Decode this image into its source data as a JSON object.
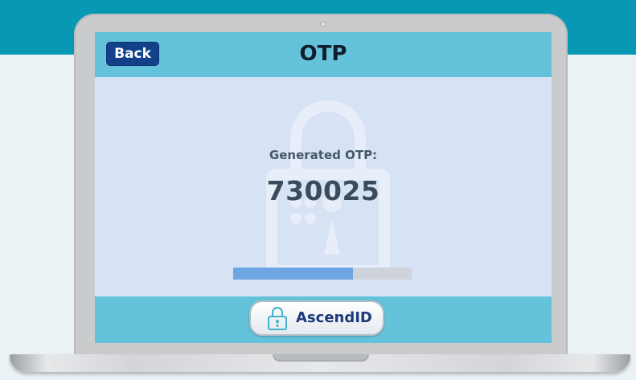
{
  "header": {
    "back_label": "Back",
    "title": "OTP"
  },
  "otp": {
    "caption": "Generated OTP:",
    "value": "730025"
  },
  "progress": {
    "fraction": 0.67,
    "fill_color": "#6ea6e4",
    "track_color": "#cfd4da"
  },
  "footer": {
    "brand_label": "AscendID",
    "brand_icon": "padlock-icon"
  },
  "colors": {
    "top_band": "#0898b3",
    "header_bar": "#64c3da",
    "screen_bg": "#d7e3f4",
    "back_button": "#12418a"
  }
}
